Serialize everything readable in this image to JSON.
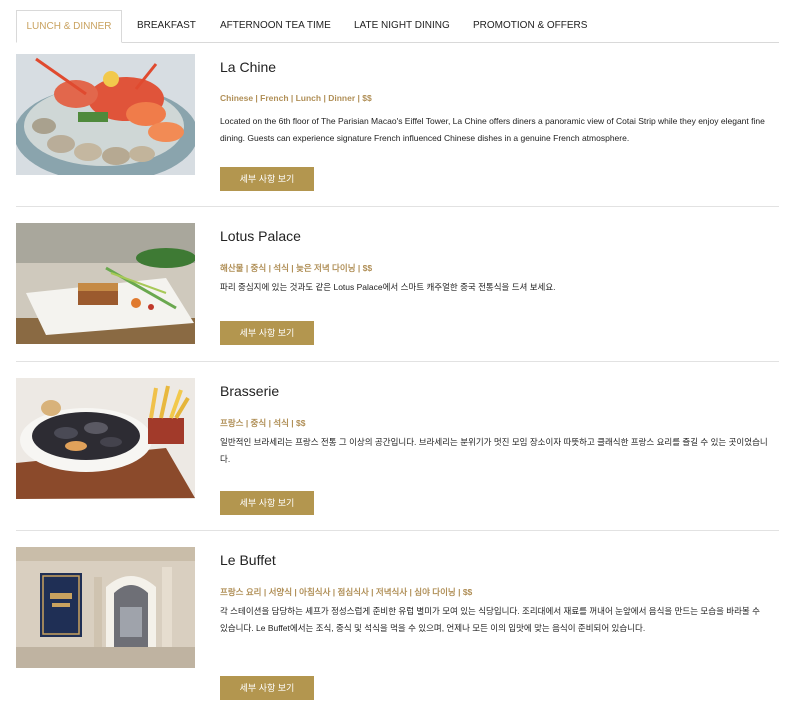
{
  "tabs": [
    {
      "label": "LUNCH & DINNER",
      "active": true
    },
    {
      "label": "BREAKFAST",
      "active": false
    },
    {
      "label": "AFTERNOON TEA TIME",
      "active": false
    },
    {
      "label": "LATE NIGHT DINING",
      "active": false
    },
    {
      "label": "PROMOTION & OFFERS",
      "active": false
    }
  ],
  "colors": {
    "accent": "#c9a25f",
    "button": "#b3964f",
    "tag": "#b08f57"
  },
  "restaurants": [
    {
      "name": "La Chine",
      "tags": "Chinese | French | Lunch | Dinner | $$",
      "description": "Located on the 6th floor of The Parisian Macao's Eiffel Tower, La Chine offers diners a panoramic view of Cotai Strip while they enjoy elegant fine dining. Guests can experience signature French influenced Chinese dishes in a genuine French atmosphere.",
      "button": "세부 사항 보기",
      "image": "seafood-platter-photo"
    },
    {
      "name": "Lotus Palace",
      "tags": "해산물 | 중식 | 석식 | 늦은 저녁 다이닝 | $$",
      "description": "파리 중심지에 있는 것과도 같은 Lotus Palace에서 스마트 캐주얼한 중국 전통식을 드셔 보세요.",
      "button": "세부 사항 보기",
      "image": "plated-dish-photo"
    },
    {
      "name": "Brasserie",
      "tags": "프랑스 | 중식 | 석식 | $$",
      "description": "일반적인 브라세리는 프랑스 전통 그 이상의 공간입니다. 브라세리는 분위기가 멋진 모임 장소이자 따뜻하고 클래식한 프랑스 요리를 즐길 수 있는 곳이었습니다.",
      "button": "세부 사항 보기",
      "image": "mussels-fries-photo"
    },
    {
      "name": "Le Buffet",
      "tags": "프랑스 요리 | 서양식 | 아침식사 | 점심식사 | 저녁식사 | 심야 다이닝 | $$",
      "description": "각 스테이션을 담당하는 셰프가 정성스럽게 준비한 유럽 별미가 모여 있는 식당입니다. 조리대에서 재료를 꺼내어 눈앞에서 음식을 만드는 모습을 바라볼 수 있습니다. Le Buffet에서는 조식, 중식 및 석식을 먹을 수 있으며, 언제나 모든 이의 입맛에 맞는 음식이 준비되어 있습니다.",
      "button": "세부 사항 보기",
      "image": "restaurant-entrance-photo"
    }
  ]
}
